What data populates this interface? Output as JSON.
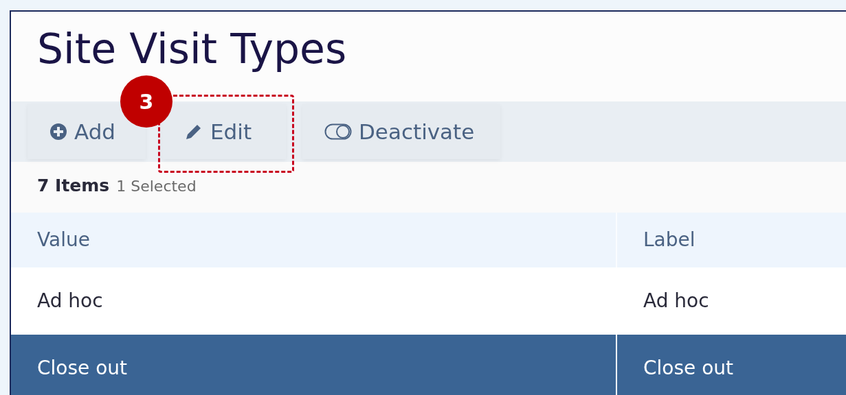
{
  "page": {
    "title": "Site Visit Types"
  },
  "toolbar": [
    {
      "kind": "add",
      "label": "Add"
    },
    {
      "kind": "edit",
      "label": "Edit",
      "callout": "3"
    },
    {
      "kind": "deactivate",
      "label": "Deactivate"
    }
  ],
  "summary": {
    "count": "7 Items",
    "selected": "1 Selected"
  },
  "table": {
    "columns": [
      "Value",
      "Label"
    ],
    "rows": [
      {
        "cells": [
          "Ad hoc",
          "Ad hoc"
        ],
        "selected": false
      },
      {
        "cells": [
          "Close out",
          "Close out"
        ],
        "selected": true
      }
    ]
  }
}
